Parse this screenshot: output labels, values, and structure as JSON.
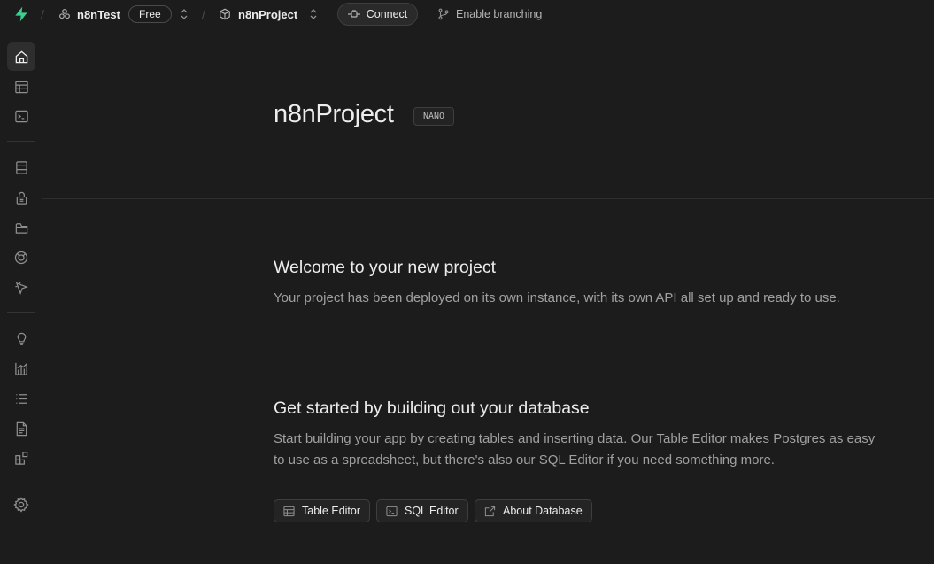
{
  "topbar": {
    "separator": "/",
    "org_name": "n8nTest",
    "plan_badge": "Free",
    "project_name": "n8nProject",
    "connect_label": "Connect",
    "branching_label": "Enable branching"
  },
  "sidebar": {
    "items": [
      {
        "name": "home",
        "icon": "home-icon",
        "active": true
      },
      {
        "name": "table-editor",
        "icon": "table-icon"
      },
      {
        "name": "sql-editor",
        "icon": "terminal-icon"
      },
      {
        "name": "database",
        "icon": "database-icon"
      },
      {
        "name": "authentication",
        "icon": "lock-icon"
      },
      {
        "name": "storage",
        "icon": "folder-icon"
      },
      {
        "name": "realtime",
        "icon": "realtime-icon"
      },
      {
        "name": "edge-functions",
        "icon": "cursor-icon"
      },
      {
        "name": "advisors",
        "icon": "lightbulb-icon"
      },
      {
        "name": "reports",
        "icon": "chart-icon"
      },
      {
        "name": "logs",
        "icon": "list-icon"
      },
      {
        "name": "api-docs",
        "icon": "document-icon"
      },
      {
        "name": "integrations",
        "icon": "integrations-icon"
      },
      {
        "name": "settings",
        "icon": "gear-icon"
      }
    ]
  },
  "main": {
    "project_title": "n8nProject",
    "tier_badge": "NANO",
    "welcome_title": "Welcome to your new project",
    "welcome_text": "Your project has been deployed on its own instance, with its own API all set up and ready to use.",
    "getting_started_title": "Get started by building out your database",
    "getting_started_text_line1": "Start building your app by creating tables and inserting data. Our Table Editor makes Postgres as easy",
    "getting_started_text_line2": "to use as a spreadsheet, but there's also our SQL Editor if you need something more.",
    "buttons": {
      "table_editor": "Table Editor",
      "sql_editor": "SQL Editor",
      "about_database": "About Database"
    }
  },
  "colors": {
    "background": "#1c1c1c",
    "brand_green": "#3ecf8e",
    "border": "#2e2e2e",
    "text_muted": "#a0a0a0"
  }
}
